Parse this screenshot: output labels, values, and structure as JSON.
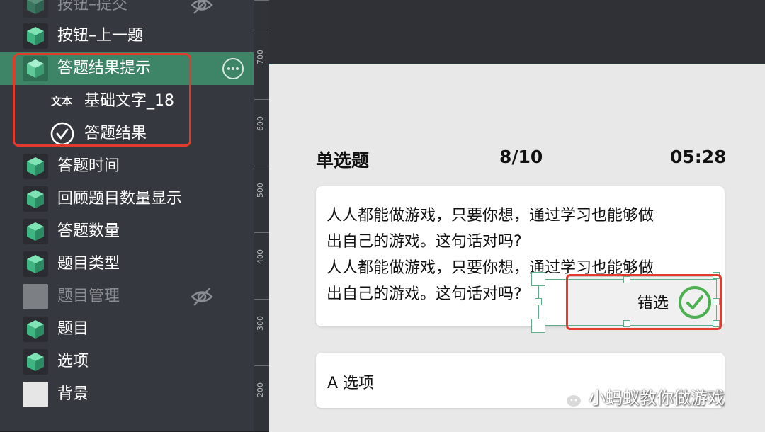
{
  "layers": [
    {
      "label": "按钮–提交",
      "icon": "green-cube-icon",
      "hidden": true
    },
    {
      "label": "按钮–上一题",
      "icon": "green-cube-icon"
    },
    {
      "label": "答题结果提示",
      "icon": "green-cube-icon",
      "selected": true
    },
    {
      "label": "基础文字_18",
      "icon": "text-icon",
      "icon_text": "文本",
      "child": true
    },
    {
      "label": "答题结果",
      "icon": "check-circle-icon",
      "child": true
    },
    {
      "label": "答题时间",
      "icon": "green-cube-icon"
    },
    {
      "label": "回顾题目数量显示",
      "icon": "green-cube-icon"
    },
    {
      "label": "答题数量",
      "icon": "green-cube-icon"
    },
    {
      "label": "题目类型",
      "icon": "green-cube-icon"
    },
    {
      "label": "题目管理",
      "icon": "gray-square-icon",
      "hidden": true
    },
    {
      "label": "题目",
      "icon": "green-cube-icon"
    },
    {
      "label": "选项",
      "icon": "green-cube-icon"
    },
    {
      "label": "背景",
      "icon": "white-square-icon"
    }
  ],
  "ruler": [
    "700",
    "600",
    "500",
    "400",
    "300",
    "200"
  ],
  "quiz": {
    "type": "单选题",
    "count": "8/10",
    "time": "05:28",
    "question_lines": [
      "人人都能做游戏，只要你想，通过学习也能够做",
      "出自己的游戏。这句话对吗?",
      "人人都能做游戏，只要你想，通过学习也能够做",
      "出自己的游戏。这句话对吗?"
    ],
    "result_label": "错选",
    "option_a": "A  选项"
  },
  "watermark": "小蚂蚁教你做游戏",
  "colors": {
    "panel_bg": "#35383e",
    "selected_bg": "#3e8466",
    "highlight_red": "#e23a2c",
    "check_green": "#4caf50",
    "cube_green": "#3fb583"
  }
}
